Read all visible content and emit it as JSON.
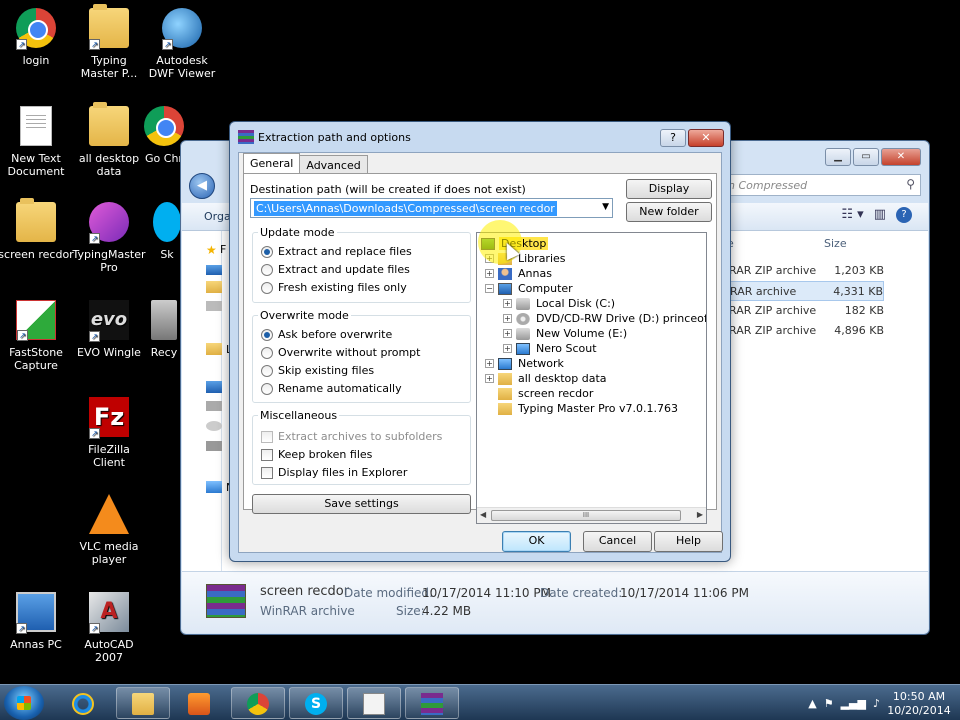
{
  "desktop": {
    "icons": [
      {
        "label": "login",
        "icon": "chrome-icon"
      },
      {
        "label": "Typing Master P...",
        "icon": "folder-icon"
      },
      {
        "label": "Autodesk DWF Viewer",
        "icon": "dwf-viewer-icon"
      },
      {
        "label": "New Text Document",
        "icon": "text-document-icon"
      },
      {
        "label": "all desktop data",
        "icon": "folder-icon"
      },
      {
        "label": "Go Chr",
        "icon": "chrome-icon"
      },
      {
        "label": "screen recdor",
        "icon": "folder-icon"
      },
      {
        "label": "TypingMaster Pro",
        "icon": "typingmaster-icon"
      },
      {
        "label": "Sk",
        "icon": "skype-icon"
      },
      {
        "label": "FastStone Capture",
        "icon": "faststone-icon"
      },
      {
        "label": "EVO Wingle",
        "icon": "evo-icon"
      },
      {
        "label": "Recy",
        "icon": "recycle-bin-icon"
      },
      {
        "label": "FileZilla Client",
        "icon": "filezilla-icon"
      },
      {
        "label": "VLC media player",
        "icon": "vlc-icon"
      },
      {
        "label": "Annas PC",
        "icon": "computer-icon"
      },
      {
        "label": "AutoCAD 2007",
        "icon": "autocad-icon"
      }
    ]
  },
  "explorer": {
    "search_placeholder": "h Compressed",
    "organize_label": "Orga",
    "col_type": "e",
    "col_size": "Size",
    "nav_letters": [
      "F",
      "L",
      "N"
    ],
    "files": [
      {
        "type": "RAR ZIP archive",
        "size": "1,203 KB"
      },
      {
        "type": "RAR archive",
        "size": "4,331 KB"
      },
      {
        "type": "RAR ZIP archive",
        "size": "182 KB"
      },
      {
        "type": "RAR ZIP archive",
        "size": "4,896 KB"
      }
    ],
    "details": {
      "name": "screen recdor",
      "kind": "WinRAR archive",
      "date_modified_label": "Date modified:",
      "date_modified": "10/17/2014 11:10 PM",
      "size_label": "Size:",
      "size": "4.22 MB",
      "date_created_label": "Date created:",
      "date_created": "10/17/2014 11:06 PM"
    }
  },
  "dialog": {
    "title": "Extraction path and options",
    "help_label": "?",
    "close_label": "✕",
    "tabs": [
      "General",
      "Advanced"
    ],
    "destination_label": "Destination path (will be created if does not exist)",
    "destination_value": "C:\\Users\\Annas\\Downloads\\Compressed\\screen recdor",
    "display_button": "Display",
    "new_folder_button": "New folder",
    "update_mode": {
      "label": "Update mode",
      "options": [
        "Extract and replace files",
        "Extract and update files",
        "Fresh existing files only"
      ],
      "selected": 0
    },
    "overwrite_mode": {
      "label": "Overwrite mode",
      "options": [
        "Ask before overwrite",
        "Overwrite without prompt",
        "Skip existing files",
        "Rename automatically"
      ],
      "selected": 0
    },
    "misc": {
      "label": "Miscellaneous",
      "options": [
        "Extract archives to subfolders",
        "Keep broken files",
        "Display files in Explorer"
      ]
    },
    "save_settings": "Save settings",
    "tree": [
      {
        "label": "Desktop",
        "level": 0,
        "icon": "desktop",
        "expander": ""
      },
      {
        "label": "Libraries",
        "level": 1,
        "icon": "folder",
        "expander": "+"
      },
      {
        "label": "Annas",
        "level": 1,
        "icon": "user",
        "expander": "+"
      },
      {
        "label": "Computer",
        "level": 1,
        "icon": "computer",
        "expander": "−"
      },
      {
        "label": "Local Disk (C:)",
        "level": 2,
        "icon": "disk",
        "expander": "+"
      },
      {
        "label": "DVD/CD-RW Drive (D:) princeofpakista",
        "level": 2,
        "icon": "dvd",
        "expander": "+"
      },
      {
        "label": "New Volume (E:)",
        "level": 2,
        "icon": "disk",
        "expander": "+"
      },
      {
        "label": "Nero Scout",
        "level": 2,
        "icon": "net",
        "expander": "+"
      },
      {
        "label": "Network",
        "level": 1,
        "icon": "net",
        "expander": "+"
      },
      {
        "label": "all desktop data",
        "level": 1,
        "icon": "folder",
        "expander": "+"
      },
      {
        "label": "screen recdor",
        "level": 1,
        "icon": "folder",
        "expander": ""
      },
      {
        "label": "Typing Master Pro v7.0.1.763",
        "level": 1,
        "icon": "folder",
        "expander": ""
      }
    ],
    "scroll_grip": "III",
    "ok": "OK",
    "cancel": "Cancel",
    "help": "Help"
  },
  "taskbar": {
    "time": "10:50 AM",
    "date": "10/20/2014"
  }
}
